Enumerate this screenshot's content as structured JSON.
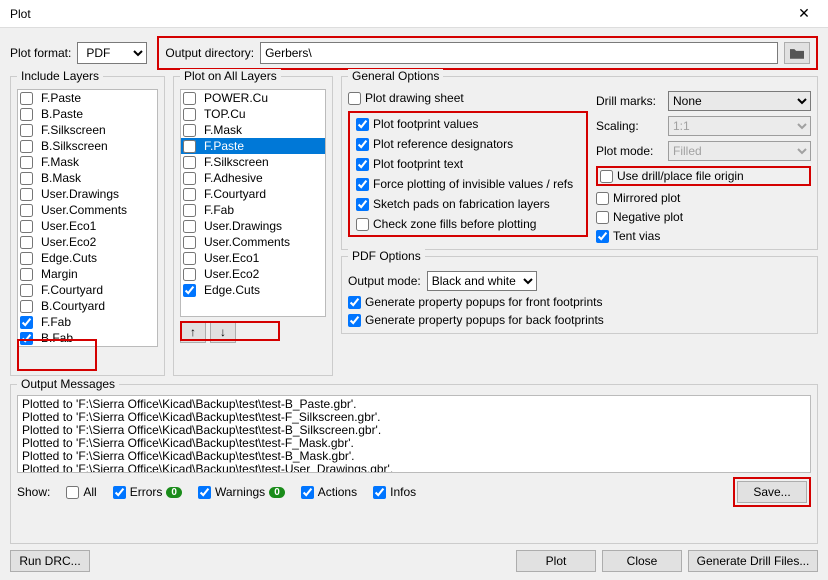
{
  "window": {
    "title": "Plot"
  },
  "plotFormat": {
    "label": "Plot format:",
    "value": "PDF"
  },
  "outputDir": {
    "label": "Output directory:",
    "value": "Gerbers\\"
  },
  "includeLayers": {
    "title": "Include Layers",
    "items": [
      {
        "label": "F.Paste",
        "checked": false
      },
      {
        "label": "B.Paste",
        "checked": false
      },
      {
        "label": "F.Silkscreen",
        "checked": false
      },
      {
        "label": "B.Silkscreen",
        "checked": false
      },
      {
        "label": "F.Mask",
        "checked": false
      },
      {
        "label": "B.Mask",
        "checked": false
      },
      {
        "label": "User.Drawings",
        "checked": false
      },
      {
        "label": "User.Comments",
        "checked": false
      },
      {
        "label": "User.Eco1",
        "checked": false
      },
      {
        "label": "User.Eco2",
        "checked": false
      },
      {
        "label": "Edge.Cuts",
        "checked": false
      },
      {
        "label": "Margin",
        "checked": false
      },
      {
        "label": "F.Courtyard",
        "checked": false
      },
      {
        "label": "B.Courtyard",
        "checked": false
      },
      {
        "label": "F.Fab",
        "checked": true
      },
      {
        "label": "B.Fab",
        "checked": true
      }
    ]
  },
  "plotAllLayers": {
    "title": "Plot on All Layers",
    "items": [
      {
        "label": "POWER.Cu",
        "checked": false,
        "selected": false
      },
      {
        "label": "TOP.Cu",
        "checked": false,
        "selected": false
      },
      {
        "label": "F.Mask",
        "checked": false,
        "selected": false
      },
      {
        "label": "F.Paste",
        "checked": false,
        "selected": true
      },
      {
        "label": "F.Silkscreen",
        "checked": false,
        "selected": false
      },
      {
        "label": "F.Adhesive",
        "checked": false,
        "selected": false
      },
      {
        "label": "F.Courtyard",
        "checked": false,
        "selected": false
      },
      {
        "label": "F.Fab",
        "checked": false,
        "selected": false
      },
      {
        "label": "User.Drawings",
        "checked": false,
        "selected": false
      },
      {
        "label": "User.Comments",
        "checked": false,
        "selected": false
      },
      {
        "label": "User.Eco1",
        "checked": false,
        "selected": false
      },
      {
        "label": "User.Eco2",
        "checked": false,
        "selected": false
      },
      {
        "label": "Edge.Cuts",
        "checked": true,
        "selected": false
      }
    ]
  },
  "generalOptions": {
    "title": "General Options",
    "drawSheet": "Plot drawing sheet",
    "footprintValues": "Plot footprint values",
    "referenceDesignators": "Plot reference designators",
    "footprintText": "Plot footprint text",
    "forceInvisible": "Force plotting of invisible values / refs",
    "sketchPads": "Sketch pads on fabrication layers",
    "checkZone": "Check zone fills before plotting",
    "drillMarks": {
      "label": "Drill marks:",
      "value": "None"
    },
    "scaling": {
      "label": "Scaling:",
      "value": "1:1"
    },
    "plotMode": {
      "label": "Plot mode:",
      "value": "Filled"
    },
    "useDrillOrigin": "Use drill/place file origin",
    "mirrored": "Mirrored plot",
    "negative": "Negative plot",
    "tentVias": "Tent vias"
  },
  "pdfOptions": {
    "title": "PDF Options",
    "outputMode": {
      "label": "Output mode:",
      "value": "Black and white"
    },
    "genFront": "Generate property popups for front footprints",
    "genBack": "Generate property popups for back footprints"
  },
  "outputMessages": {
    "title": "Output Messages",
    "lines": [
      "Plotted to 'F:\\Sierra Office\\Kicad\\Backup\\test\\test-B_Paste.gbr'.",
      "Plotted to 'F:\\Sierra Office\\Kicad\\Backup\\test\\test-F_Silkscreen.gbr'.",
      "Plotted to 'F:\\Sierra Office\\Kicad\\Backup\\test\\test-B_Silkscreen.gbr'.",
      "Plotted to 'F:\\Sierra Office\\Kicad\\Backup\\test\\test-F_Mask.gbr'.",
      "Plotted to 'F:\\Sierra Office\\Kicad\\Backup\\test\\test-B_Mask.gbr'.",
      "Plotted to 'F:\\Sierra Office\\Kicad\\Backup\\test\\test-User_Drawings.gbr'."
    ],
    "showLabel": "Show:",
    "all": "All",
    "errors": "Errors",
    "errorsCount": "0",
    "warnings": "Warnings",
    "warningsCount": "0",
    "actions": "Actions",
    "infos": "Infos",
    "save": "Save..."
  },
  "buttons": {
    "runDrc": "Run DRC...",
    "plot": "Plot",
    "close": "Close",
    "genDrill": "Generate Drill Files..."
  }
}
